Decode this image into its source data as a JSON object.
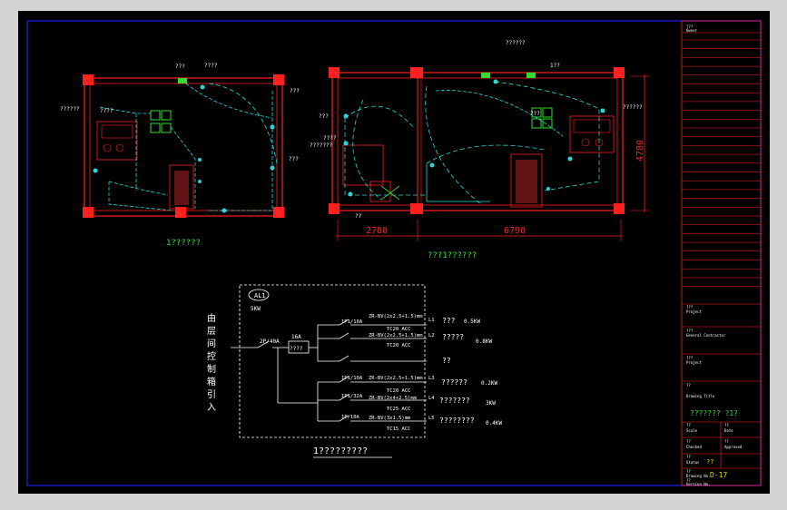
{
  "colors": {
    "frame": "#1a1ad8",
    "wall": "#ff2020",
    "wire": "#26d9d9",
    "fixture": "#33dd33",
    "text": "#ffffff",
    "dim": "#ff2020",
    "label": "#d8d800"
  },
  "plans": {
    "left_title": "1??????",
    "right_title": "???1??????",
    "dim_width_left": "2780",
    "dim_width_right": "6790",
    "dim_height": "4780",
    "left_callouts": [
      "????",
      "???",
      "????",
      "??????",
      "???",
      "???"
    ],
    "right_callouts": [
      "??????",
      "1??",
      "???",
      "???????",
      "???",
      "??????",
      "??",
      "????"
    ]
  },
  "schematic": {
    "box_tag": "AL1",
    "box_sub": "5KW",
    "incoming_vertical": [
      "由",
      "层",
      "间",
      "控",
      "制",
      "箱",
      "引",
      "入"
    ],
    "main_breaker": "2P/40A",
    "rcd_rating": "16A",
    "rcd_label": "????",
    "title": "1?????????",
    "circuits": [
      {
        "breaker": "1P1/10A",
        "cable": "ZR-BV(2x2.5+1.5)mm",
        "conduit": "TC20  ACC",
        "id": "L1",
        "load_name": "???",
        "load_power": "0.5KW"
      },
      {
        "breaker": "",
        "cable": "ZR-BV(2x2.5+1.5)mm",
        "conduit": "TC20  ACC",
        "id": "L2",
        "load_name": "?????",
        "load_power": "0.8KW"
      },
      {
        "breaker": "",
        "cable": "",
        "conduit": "",
        "id": "",
        "load_name": "??",
        "load_power": ""
      },
      {
        "breaker": "1P1/10A",
        "cable": "ZR-BV(2x2.5+1.5)mm",
        "conduit": "TC20  ACC",
        "id": "L3",
        "load_name": "??????",
        "load_power": "0.2KW"
      },
      {
        "breaker": "1P1/32A",
        "cable": "ZR-BV(2x4+2.5)mm",
        "conduit": "TC25  ACC",
        "id": "L4",
        "load_name": "???????",
        "load_power": "3KW"
      },
      {
        "breaker": "1P/10A",
        "cable": "ZR-BV(3x1.5)mm",
        "conduit": "TC15  ACC",
        "id": "L5",
        "load_name": "????????",
        "load_power": "0.4KW"
      }
    ]
  },
  "title_block": {
    "rows": [
      {
        "cn": "???",
        "en": "Owner"
      },
      {
        "cn": "???",
        "en": "Project"
      },
      {
        "cn": "???",
        "en": "General Contractor"
      },
      {
        "cn": "???",
        "en": "Project"
      }
    ],
    "drawing_title_cn": "??",
    "drawing_title_en": "Drawing Title",
    "drawing_name": "???????  ?1?",
    "scale_cn": "??",
    "scale_en": "Scale",
    "date_cn": "??",
    "date_en": "Date",
    "sheet_cn": "??",
    "sheet_en": "Checked",
    "approved_cn": "??",
    "approved_en": "Approved",
    "type_cn": "??",
    "type_en": "Status",
    "type_value": "??",
    "drawing_no_cn": "??",
    "drawing_no_en": "Drawing No.",
    "drawing_no_value": "D-17",
    "version_cn": "??",
    "version_en": "Version No."
  }
}
